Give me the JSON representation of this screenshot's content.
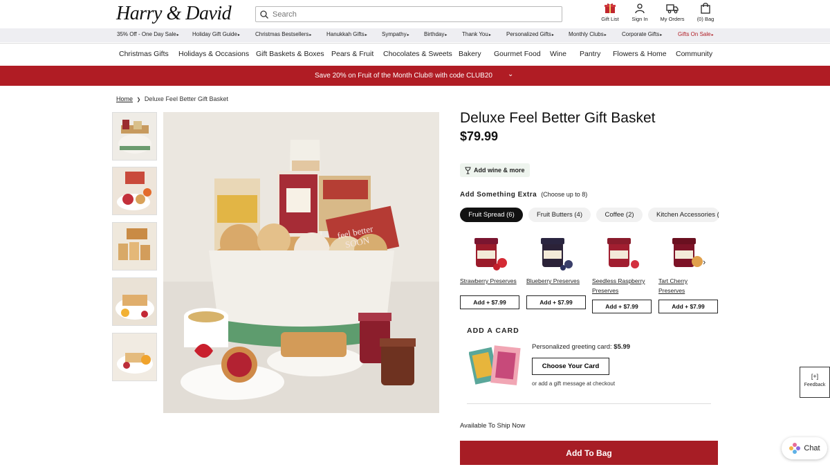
{
  "header": {
    "logo": "Harry & David",
    "search_placeholder": "Search",
    "icons": [
      {
        "label": "Gift List",
        "icon": "gift-icon"
      },
      {
        "label": "Sign In",
        "icon": "person-icon"
      },
      {
        "label": "My Orders",
        "icon": "truck-icon"
      },
      {
        "label": "(0) Bag",
        "icon": "bag-icon"
      }
    ]
  },
  "promo_nav": [
    "35% Off - One Day Sale",
    "Holiday Gift Guide",
    "Christmas Bestsellers",
    "Hanukkah Gifts",
    "Sympathy",
    "Birthday",
    "Thank You",
    "Personalized Gifts",
    "Monthly Clubs",
    "Corporate Gifts",
    "Gifts On Sale"
  ],
  "main_nav": [
    "Christmas Gifts",
    "Holidays & Occasions",
    "Gift Baskets & Boxes",
    "Pears & Fruit",
    "Chocolates & Sweets",
    "Bakery",
    "Gourmet Food",
    "Wine",
    "Pantry",
    "Flowers & Home",
    "Community"
  ],
  "banner": {
    "text": "Save 20% on Fruit of the Month Club® with code CLUB20"
  },
  "breadcrumb": {
    "home": "Home",
    "separator": "❯",
    "current": "Deluxe Feel Better Gift Basket"
  },
  "product": {
    "title": "Deluxe Feel Better Gift Basket",
    "price": "$79.99",
    "wine_label": "Add wine & more"
  },
  "extras": {
    "heading": "Add Something Extra",
    "subheading": "(Choose up to 8)",
    "tabs": [
      "Fruit Spread (6)",
      "Fruit Butters (4)",
      "Coffee (2)",
      "Kitchen Accessories ("
    ],
    "items": [
      {
        "name": "Strawberry Preserves",
        "button": "Add + $7.99",
        "lid": "#7a1530"
      },
      {
        "name": "Blueberry Preserves",
        "button": "Add + $7.99",
        "lid": "#2a2540"
      },
      {
        "name": "Seedless Raspberry Preserves",
        "button": "Add + $7.99",
        "lid": "#8a1c2c"
      },
      {
        "name": "Tart Cherry Preserves",
        "button": "Add + $7.99",
        "lid": "#6a1020"
      }
    ]
  },
  "card": {
    "heading": "ADD A CARD",
    "price_label": "Personalized greeting card:",
    "price": "$5.99",
    "button": "Choose Your Card",
    "note": "or add a gift message at checkout"
  },
  "hero_labels": [
    "feel better",
    "SOON"
  ],
  "availability": "Available To Ship Now",
  "add_to_bag": "Add To Bag",
  "feedback": {
    "symbol": "[+]",
    "label": "Feedback"
  },
  "chat": {
    "label": "Chat"
  },
  "colors": {
    "brand_red": "#b01c24",
    "bag_button": "#a71d25"
  }
}
